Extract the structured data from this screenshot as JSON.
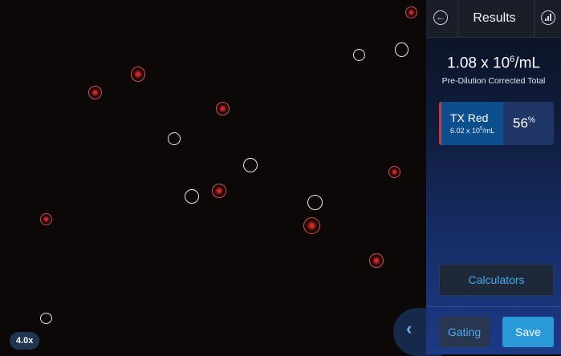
{
  "viewer": {
    "zoom_label": "4.0x"
  },
  "panel": {
    "title": "Results",
    "total": {
      "value": "1.08 x 10",
      "exponent": "6",
      "unit": "/mL",
      "label": "Pre-Dilution Corrected Total"
    },
    "channel": {
      "name": "TX Red",
      "concentration_value": "6.02 x 10",
      "concentration_exponent": "5",
      "concentration_unit": "/mL",
      "percent_value": "56",
      "percent_unit": "%",
      "color": "#c23b47"
    },
    "calculators_label": "Calculators",
    "gating_label": "Gating",
    "save_label": "Save"
  },
  "icons": {
    "back": "arrow-left-circle-icon",
    "stats": "bar-chart-circle-icon",
    "collapse": "chevron-left-icon"
  },
  "colors": {
    "accent": "#2a9bd8",
    "link_text": "#46a9ec",
    "red_cell": "#e8332f",
    "white_cell": "#e6e6e6"
  }
}
